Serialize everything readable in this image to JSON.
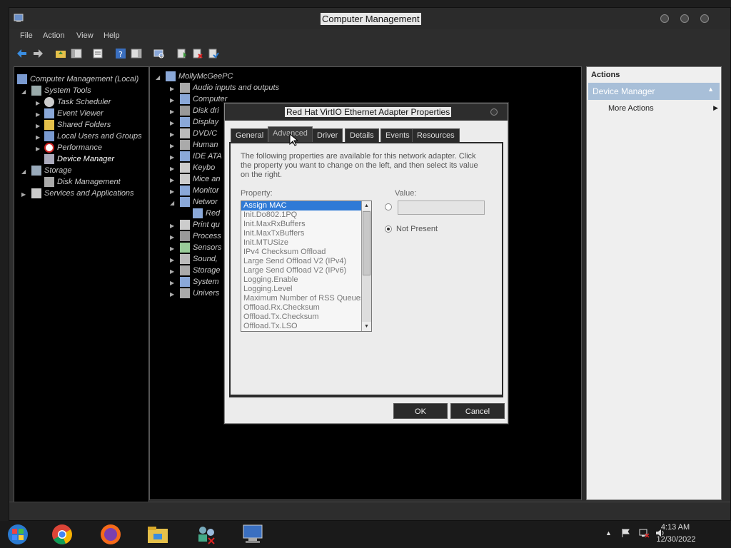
{
  "window": {
    "title": "Computer Management"
  },
  "menubar": {
    "items": [
      "File",
      "Action",
      "View",
      "Help"
    ]
  },
  "tree": {
    "root": "Computer Management (Local)",
    "system_tools": "System Tools",
    "task_scheduler": "Task Scheduler",
    "event_viewer": "Event Viewer",
    "shared_folders": "Shared Folders",
    "local_users": "Local Users and Groups",
    "performance": "Performance",
    "device_manager": "Device Manager",
    "storage": "Storage",
    "disk_management": "Disk Management",
    "services": "Services and Applications"
  },
  "devices": {
    "pc": "MollyMcGeePC",
    "items": [
      "Audio inputs and outputs",
      "Computer",
      "Disk dri",
      "Display",
      "DVD/C",
      "Human",
      "IDE ATA",
      "Keybo",
      "Mice an",
      "Monitor",
      "Networ",
      "Red",
      "Print qu",
      "Process",
      "Sensors",
      "Sound,",
      "Storage",
      "System",
      "Univers"
    ]
  },
  "actions": {
    "title": "Actions",
    "subtitle": "Device Manager",
    "more": "More Actions"
  },
  "dialog": {
    "title": "Red Hat VirtIO Ethernet Adapter Properties",
    "tabs": [
      "General",
      "Advanced",
      "Driver",
      "Details",
      "Events",
      "Resources"
    ],
    "intro": "The following properties are available for this network adapter. Click the property you want to change on the left, and then select its value on the right.",
    "property_label": "Property:",
    "value_label": "Value:",
    "properties": [
      "Assign MAC",
      "Init.Do802.1PQ",
      "Init.MaxRxBuffers",
      "Init.MaxTxBuffers",
      "Init.MTUSize",
      "IPv4 Checksum Offload",
      "Large Send Offload V2 (IPv4)",
      "Large Send Offload V2 (IPv6)",
      "Logging.Enable",
      "Logging.Level",
      "Maximum Number of RSS Queues",
      "Offload.Rx.Checksum",
      "Offload.Tx.Checksum",
      "Offload.Tx.LSO"
    ],
    "not_present": "Not Present",
    "ok": "OK",
    "cancel": "Cancel"
  },
  "taskbar": {
    "time": "4:13 AM",
    "date": "12/30/2022"
  }
}
